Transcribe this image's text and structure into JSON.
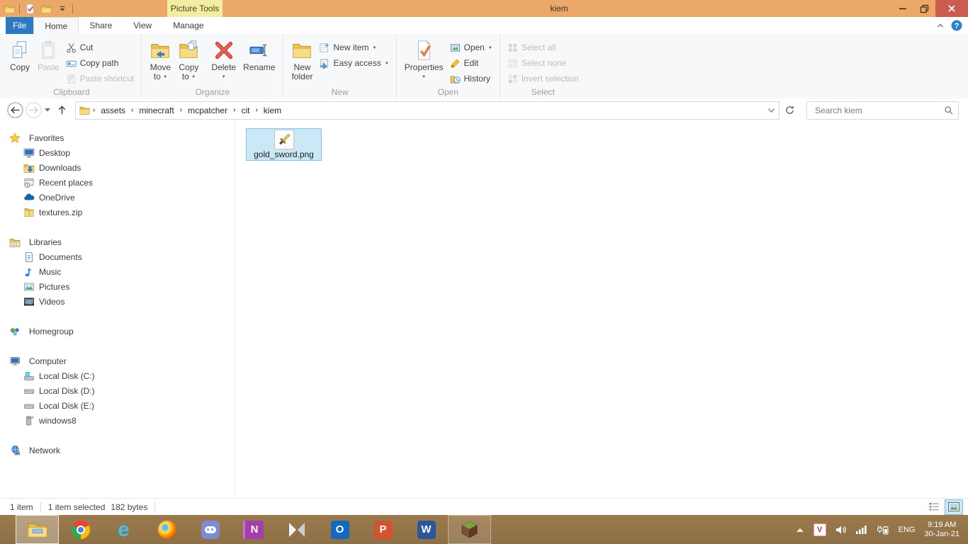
{
  "window": {
    "title": "kiem",
    "help_glyph": "?"
  },
  "titlebar": {
    "contextual_tab": "Picture Tools"
  },
  "tabs": {
    "file": "File",
    "home": "Home",
    "share": "Share",
    "view": "View",
    "manage": "Manage"
  },
  "ribbon": {
    "clipboard": {
      "label": "Clipboard",
      "copy": "Copy",
      "paste": "Paste",
      "cut": "Cut",
      "copy_path": "Copy path",
      "paste_shortcut": "Paste shortcut"
    },
    "organize": {
      "label": "Organize",
      "move_1": "Move",
      "move_2": "to",
      "copy_1": "Copy",
      "copy_2": "to",
      "delete": "Delete",
      "rename": "Rename"
    },
    "new_group": {
      "label": "New",
      "folder_1": "New",
      "folder_2": "folder",
      "new_item": "New item",
      "easy_access": "Easy access"
    },
    "open_group": {
      "label": "Open",
      "properties": "Properties",
      "open": "Open",
      "edit": "Edit",
      "history": "History"
    },
    "select_group": {
      "label": "Select",
      "all": "Select all",
      "none": "Select none",
      "invert": "Invert selection"
    }
  },
  "address": {
    "crumbs": [
      "assets",
      "minecraft",
      "mcpatcher",
      "cit",
      "kiem"
    ]
  },
  "search": {
    "placeholder": "Search kiem"
  },
  "sidebar": {
    "favorites": {
      "label": "Favorites",
      "items": [
        "Desktop",
        "Downloads",
        "Recent places",
        "OneDrive",
        "textures.zip"
      ]
    },
    "libraries": {
      "label": "Libraries",
      "items": [
        "Documents",
        "Music",
        "Pictures",
        "Videos"
      ]
    },
    "homegroup": {
      "label": "Homegroup"
    },
    "computer": {
      "label": "Computer",
      "items": [
        "Local Disk (C:)",
        "Local Disk (D:)",
        "Local Disk (E:)",
        "windows8"
      ]
    },
    "network": {
      "label": "Network"
    }
  },
  "content": {
    "file_name": "gold_sword.png"
  },
  "statusbar": {
    "count": "1 item",
    "selected": "1 item selected",
    "size": "182 bytes"
  },
  "taskbar": {
    "letters": {
      "internet_explorer": "e",
      "onenote": "N",
      "outlook": "O",
      "powerpoint": "P",
      "word": "W"
    }
  },
  "tray": {
    "v_badge": "V",
    "language": "ENG",
    "time": "9:19 AM",
    "date": "30-Jan-21"
  }
}
